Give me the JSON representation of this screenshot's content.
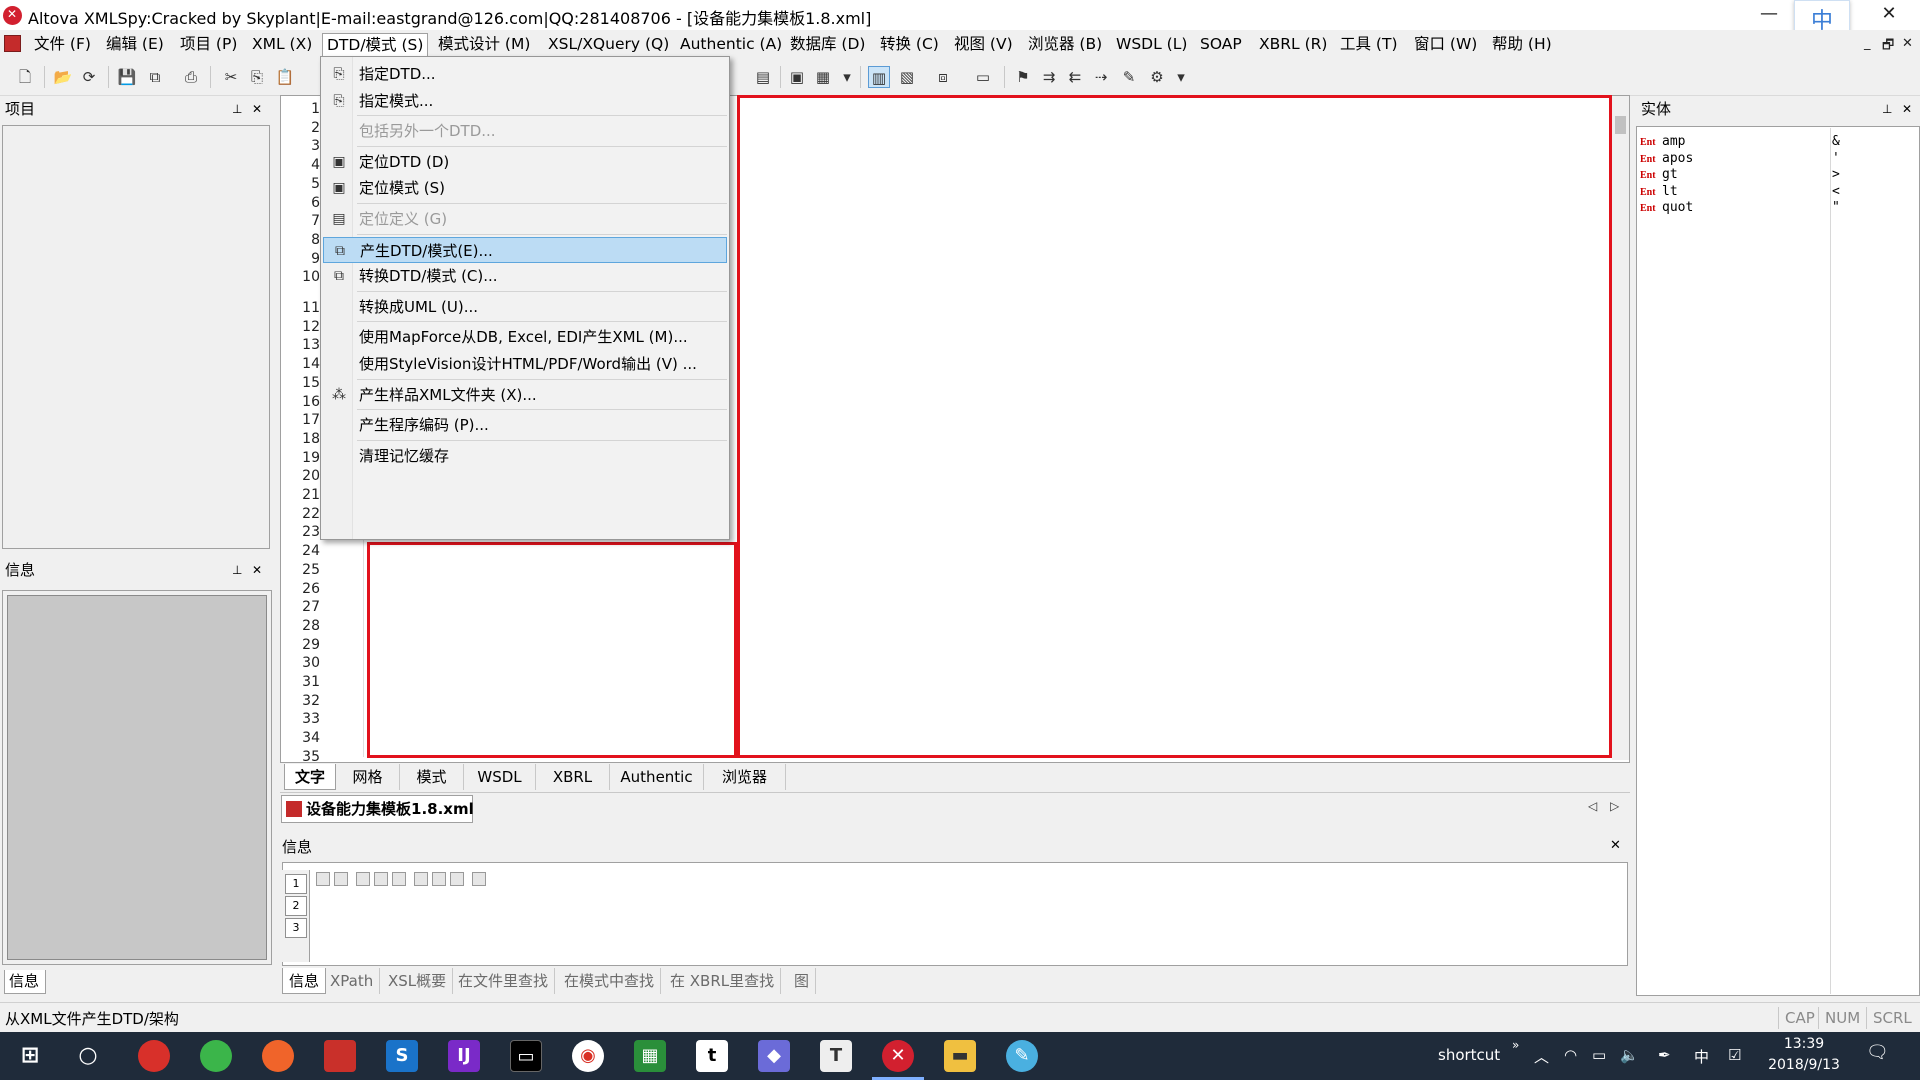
{
  "window": {
    "title": "Altova XMLSpy:Cracked by Skyplant|E-mail:eastgrand@126.com|QQ:281408706 - [设备能力集模板1.8.xml]",
    "minimize": "—",
    "maximize": "☐",
    "close": "✕",
    "ime": "中"
  },
  "menubar": {
    "items": [
      "文件 (F)",
      "编辑 (E)",
      "项目 (P)",
      "XML (X)",
      "DTD/模式 (S)",
      "模式设计 (M)",
      "XSL/XQuery (Q)",
      "Authentic (A)",
      "数据库 (D)",
      "转换 (C)",
      "视图 (V)",
      "浏览器 (B)",
      "WSDL (L)",
      "SOAP",
      "XBRL (R)",
      "工具 (T)",
      "窗口 (W)",
      "帮助 (H)"
    ],
    "active_index": 4,
    "mdi": [
      "_",
      "🗗",
      "✕"
    ]
  },
  "dropdown": {
    "items": [
      {
        "label": "指定DTD...",
        "icon": "assign-dtd-icon",
        "glyph": "⎘",
        "disabled": false
      },
      {
        "label": "指定模式...",
        "icon": "assign-schema-icon",
        "glyph": "⎘",
        "disabled": false
      },
      {
        "sep": true
      },
      {
        "label": "包括另外一个DTD...",
        "icon": "",
        "glyph": "",
        "disabled": true
      },
      {
        "sep": true
      },
      {
        "label": "定位DTD (D)",
        "icon": "goto-dtd-icon",
        "glyph": "▣",
        "disabled": false
      },
      {
        "label": "定位模式 (S)",
        "icon": "goto-schema-icon",
        "glyph": "▣",
        "disabled": false
      },
      {
        "sep": true
      },
      {
        "label": "定位定义 (G)",
        "icon": "goto-definition-icon",
        "glyph": "▤",
        "disabled": true
      },
      {
        "sep": true
      },
      {
        "label": "产生DTD/模式(E)...",
        "icon": "generate-dtd-icon",
        "glyph": "⧉",
        "disabled": false,
        "highlight": true
      },
      {
        "label": "转换DTD/模式 (C)...",
        "icon": "convert-dtd-icon",
        "glyph": "⧉",
        "disabled": false
      },
      {
        "sep": true
      },
      {
        "label": "转换成UML (U)...",
        "icon": "",
        "glyph": "",
        "disabled": false
      },
      {
        "sep": true
      },
      {
        "label": "使用MapForce从DB, Excel, EDI产生XML (M)...",
        "icon": "",
        "glyph": "",
        "disabled": false
      },
      {
        "label": "使用StyleVision设计HTML/PDF/Word输出 (V) ...",
        "icon": "",
        "glyph": "",
        "disabled": false
      },
      {
        "sep": true
      },
      {
        "label": "产生样品XML文件夹 (X)...",
        "icon": "generate-sample-icon",
        "glyph": "⁂",
        "disabled": false
      },
      {
        "sep": true
      },
      {
        "label": "产生程序编码 (P)...",
        "icon": "",
        "glyph": "",
        "disabled": false
      },
      {
        "sep": true
      },
      {
        "label": "清理记忆缓存",
        "icon": "",
        "glyph": "",
        "disabled": false
      }
    ]
  },
  "panels": {
    "project_title": "项目",
    "info_left_title": "信息",
    "info_left_tab": "信息",
    "entities_title": "实体",
    "pin": "⊥",
    "close": "✕"
  },
  "editor": {
    "line_numbers": [
      "1",
      "2",
      "3",
      "4",
      "5",
      "6",
      "7",
      "8",
      "9",
      "10",
      "11",
      "12",
      "13",
      "14",
      "15",
      "16",
      "17",
      "18",
      "19",
      "20",
      "21",
      "22",
      "23",
      "24",
      "25",
      "26",
      "27",
      "28",
      "29",
      "30",
      "31",
      "32",
      "33",
      "34",
      "35"
    ],
    "view_tabs": [
      "文字",
      "网格",
      "模式",
      "WSDL",
      "XBRL",
      "Authentic",
      "浏览器"
    ],
    "active_view": "文字",
    "doc_tab": "设备能力集模板1.8.xml"
  },
  "info_bottom": {
    "title": "信息",
    "close": "✕",
    "side_tabs": [
      "1",
      "2",
      "3"
    ],
    "tabs": [
      "信息",
      "XPath",
      "XSL概要",
      "在文件里查找",
      "在模式中查找",
      "在 XBRL里查找",
      "图"
    ],
    "active_tab": "信息"
  },
  "entities": [
    {
      "badge": "Ent",
      "name": "amp",
      "value": "&"
    },
    {
      "badge": "Ent",
      "name": "apos",
      "value": "'"
    },
    {
      "badge": "Ent",
      "name": "gt",
      "value": ">"
    },
    {
      "badge": "Ent",
      "name": "lt",
      "value": "<"
    },
    {
      "badge": "Ent",
      "name": "quot",
      "value": "\""
    }
  ],
  "statusbar": {
    "text": "从XML文件产生DTD/架构",
    "indicators": [
      "CAP",
      "NUM",
      "SCRL"
    ]
  },
  "taskbar": {
    "shortcut": "shortcut",
    "chevron": "»",
    "time": "13:39",
    "date": "2018/9/13",
    "ime": "中"
  },
  "colors": {
    "highlight": "#bcdcf4",
    "red_box": "#e2121c",
    "taskbar": "#1f2b3a"
  }
}
